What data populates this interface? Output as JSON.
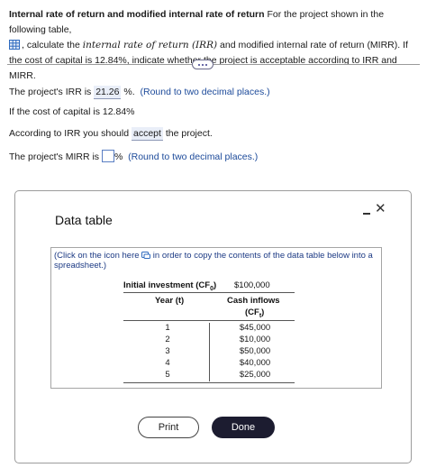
{
  "question": {
    "title": "Internal rate of return and modified internal rate of return",
    "text1": " For the project shown in the following table,",
    "text2": ", calculate the ",
    "irr_term": "internal rate of return (IRR)",
    "text3": " and modified internal rate of return (MIRR).",
    "text4": " If the cost of capital is 12.84%, indicate whether the project is acceptable according to IRR and MIRR."
  },
  "answers": {
    "irr_prefix": "The project's IRR is ",
    "irr_value": "21.26",
    "irr_suffix": " %.",
    "irr_hint": "(Round to two decimal places.)",
    "cost_line": "If the cost of capital is 12.84%",
    "accept_prefix": "According to IRR you should ",
    "accept_value": "accept",
    "accept_suffix": " the project.",
    "mirr_prefix": "The project's MIRR is ",
    "mirr_input_value": "",
    "mirr_suffix": "%",
    "mirr_hint": "(Round to two decimal places.)"
  },
  "dialog": {
    "title": "Data table",
    "info_part1": "(Click on the icon here ",
    "info_part2": " in order to copy the contents of the data table below into a spreadsheet.)",
    "initial_investment_label": "Initial investment (CF",
    "initial_investment_sub": "0",
    "initial_investment_close": ")",
    "initial_investment_value": "$100,000",
    "year_header": "Year (t)",
    "cf_header_1": "Cash inflows",
    "cf_header_2_open": "(CF",
    "cf_header_2_sub": "t",
    "cf_header_2_close": ")",
    "rows": [
      {
        "year": "1",
        "cf": "$45,000"
      },
      {
        "year": "2",
        "cf": "$10,000"
      },
      {
        "year": "3",
        "cf": "$50,000"
      },
      {
        "year": "4",
        "cf": "$40,000"
      },
      {
        "year": "5",
        "cf": "$25,000"
      }
    ],
    "print_label": "Print",
    "done_label": "Done"
  },
  "colors": {
    "link_blue": "#1c4a9a",
    "answer_bg": "#e9eef8",
    "done_bg": "#1c1c30"
  }
}
